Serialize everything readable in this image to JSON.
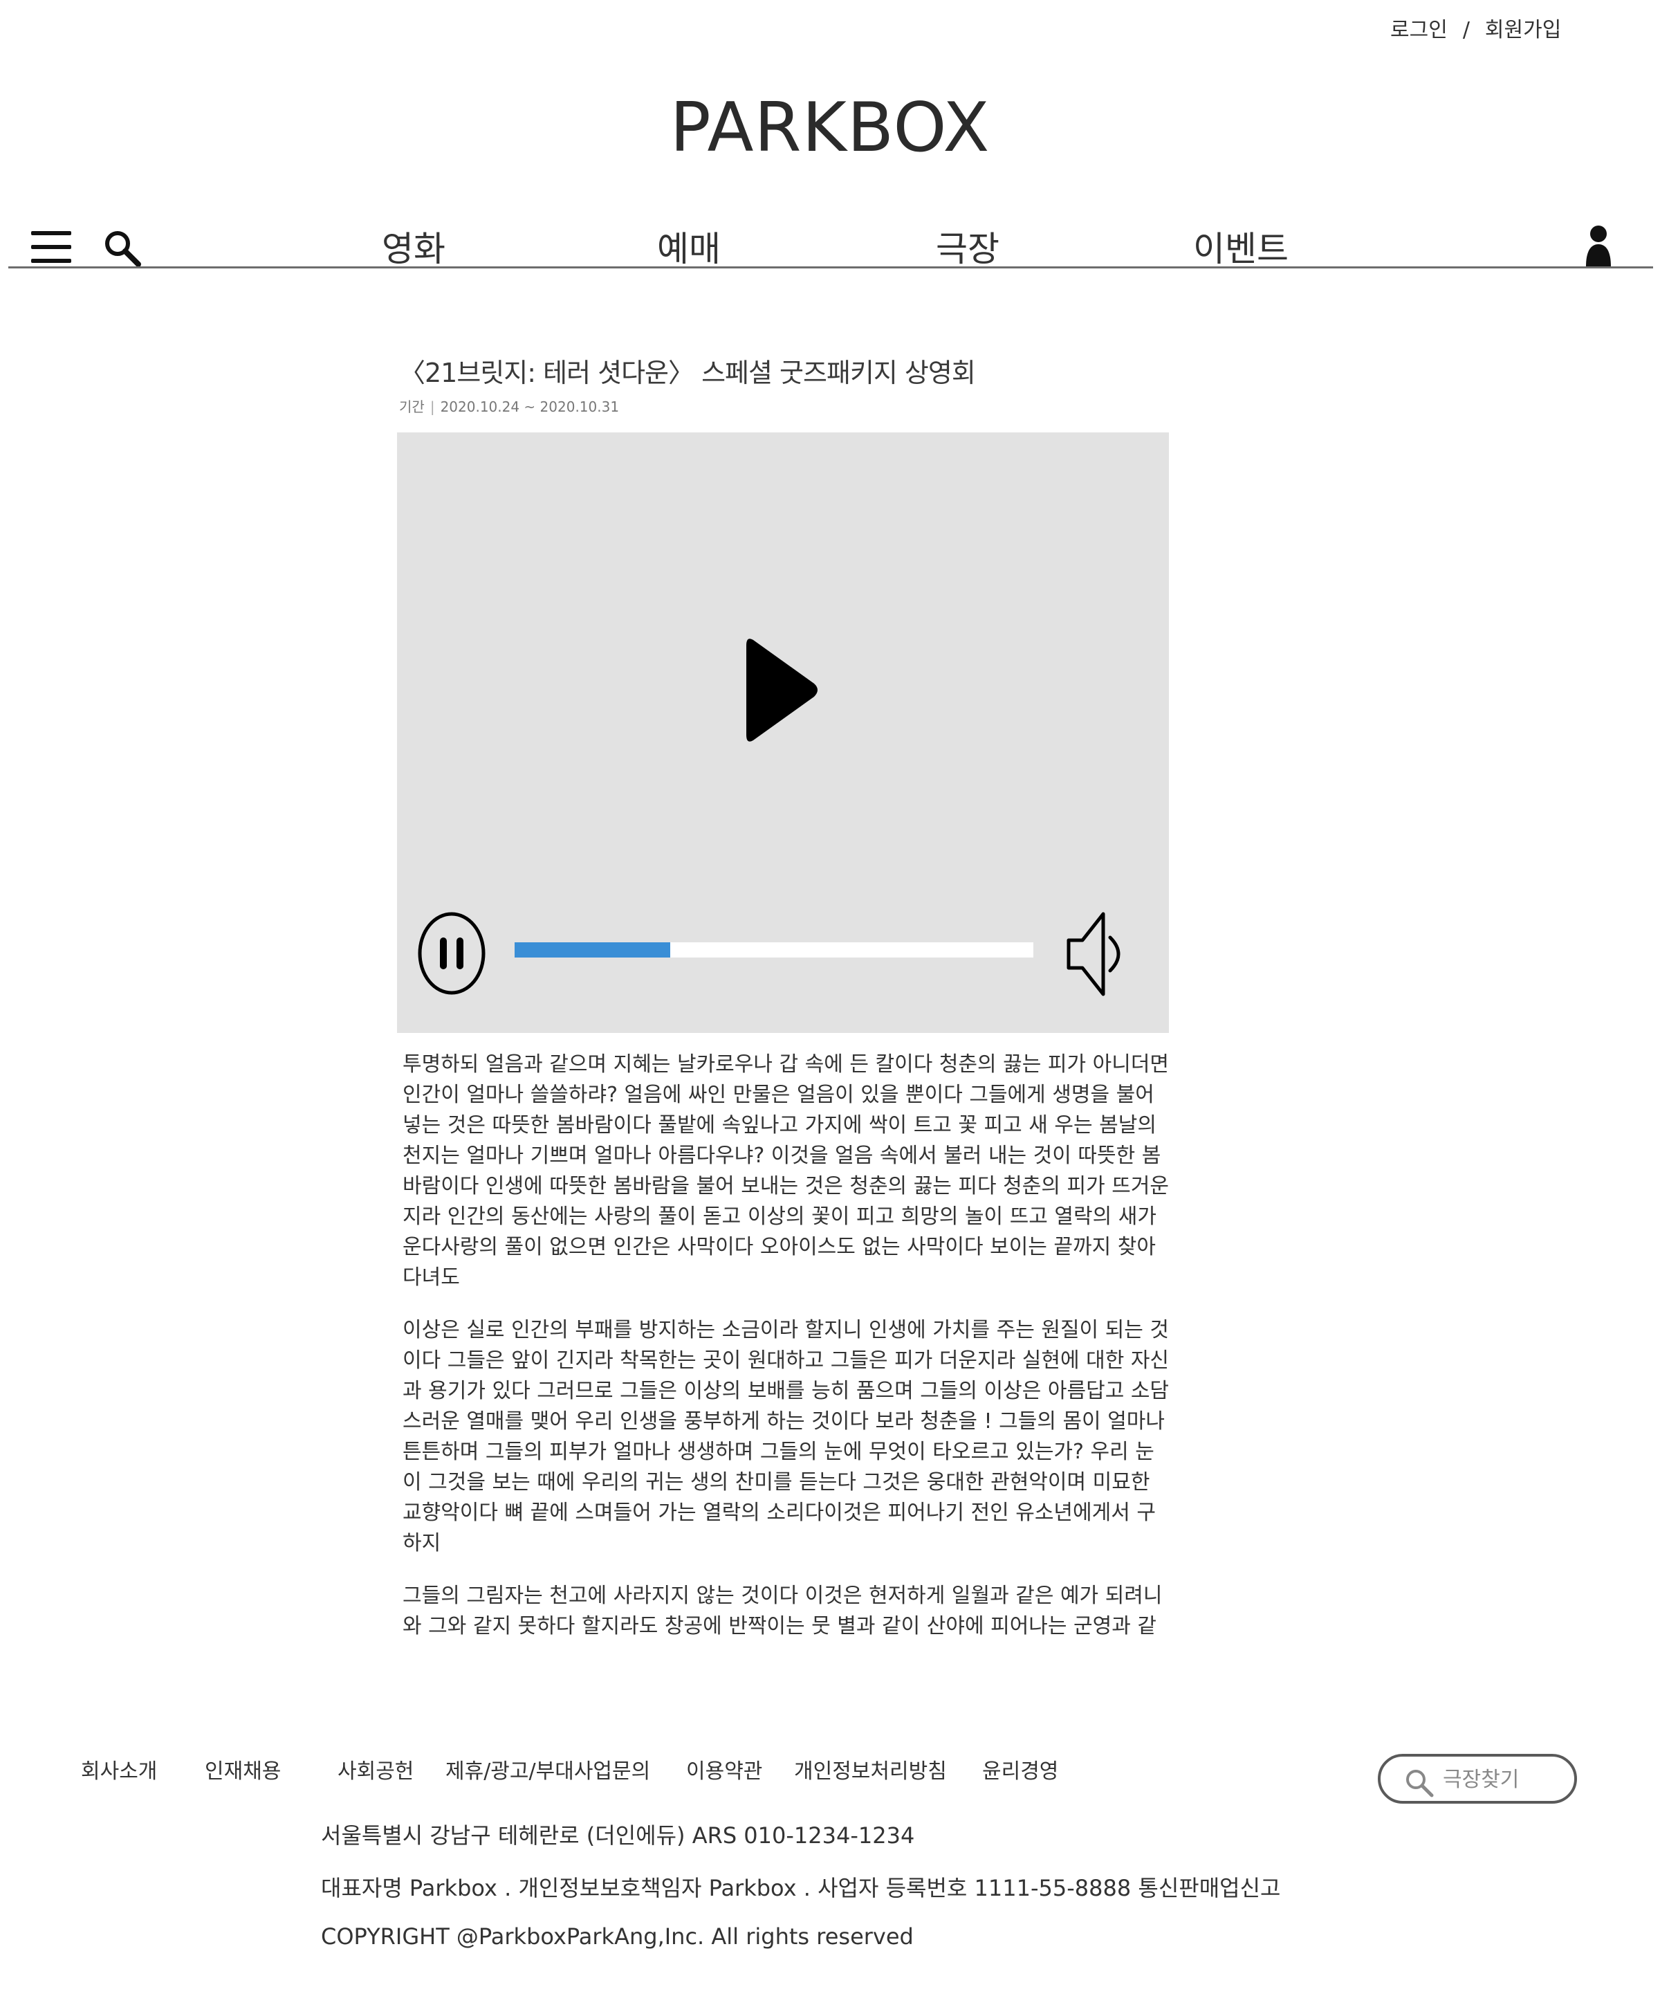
{
  "auth": {
    "login": "로그인",
    "separator": "/",
    "signup": "회원가입"
  },
  "header": {
    "logo": "PARKBOX"
  },
  "nav": {
    "items": [
      "영화",
      "예매",
      "극장",
      "이벤트"
    ],
    "menu_icon": "hamburger-menu-icon",
    "search_icon": "search-icon",
    "user_icon": "user-icon"
  },
  "article": {
    "title": "〈21브릿지: 테러 셧다운〉 스페셜 굿즈패키지 상영회",
    "period_label": "기간",
    "period_sep": "|",
    "period_value": "2020.10.24 ~ 2020.10.31",
    "paragraphs": [
      "투명하되 얼음과 같으며 지혜는 날카로우나 갑 속에 든 칼이다 청춘의 끓는 피가 아니더면 인간이 얼마나 쓸쓸하랴? 얼음에 싸인 만물은 얼음이 있을 뿐이다 그들에게 생명을 불어 넣는 것은 따뜻한 봄바람이다 풀밭에 속잎나고 가지에 싹이 트고 꽃 피고 새 우는 봄날의 천지는 얼마나 기쁘며 얼마나 아름다우냐? 이것을 얼음 속에서 불러 내는 것이 따뜻한 봄바람이다 인생에 따뜻한 봄바람을 불어 보내는 것은 청춘의 끓는 피다 청춘의 피가 뜨거운지라 인간의 동산에는 사랑의 풀이 돋고 이상의 꽃이 피고 희망의 놀이 뜨고 열락의 새가 운다사랑의 풀이 없으면 인간은 사막이다 오아이스도 없는 사막이다 보이는 끝까지 찾아다녀도",
      "이상은 실로 인간의 부패를 방지하는 소금이라 할지니 인생에 가치를 주는 원질이 되는 것이다 그들은 앞이 긴지라 착목한는 곳이 원대하고 그들은 피가 더운지라 실현에 대한 자신과 용기가 있다 그러므로 그들은 이상의 보배를 능히 품으며 그들의 이상은 아름답고 소담스러운 열매를 맺어 우리 인생을 풍부하게 하는 것이다 보라 청춘을 ! 그들의 몸이 얼마나 튼튼하며 그들의 피부가 얼마나 생생하며 그들의 눈에 무엇이 타오르고 있는가? 우리 눈이 그것을 보는 때에 우리의 귀는 생의 찬미를 듣는다 그것은 웅대한 관현악이며 미묘한 교향악이다 뼈 끝에 스며들어 가는 열락의 소리다이것은 피어나기 전인 유소년에게서 구하지",
      "그들의 그림자는 천고에 사라지지 않는 것이다 이것은 현저하게 일월과 같은 예가 되려니와 그와 같지 못하다 할지라도 창공에 반짝이는 뭇 별과 같이 산야에 피어나는 군영과 같이 이상은 실로 인간의 부패를 방지하는 소금이라 할지니 인생에 가치를 주는 원질이 되는 것이다"
    ]
  },
  "player": {
    "progress": 0.3,
    "accent_color": "#3a8ed6",
    "play_icon": "play-icon",
    "pause_icon": "pause-icon",
    "volume_icon": "volume-icon"
  },
  "footer": {
    "links": [
      "회사소개",
      "인재채용",
      "사회공헌",
      "제휴/광고/부대사업문의",
      "이용약관",
      "개인정보처리방침",
      "윤리경영"
    ],
    "theater_search_placeholder": "극장찾기",
    "address": "서울특별시 강남구 테헤란로 (더인에듀) ARS 010-1234-1234",
    "company_info": "대표자명 Parkbox . 개인정보보호책임자 Parkbox . 사업자 등록번호 1111-55-8888 통신판매업신고",
    "copyright": "COPYRIGHT @ParkboxParkAng,Inc. All rights reserved"
  }
}
